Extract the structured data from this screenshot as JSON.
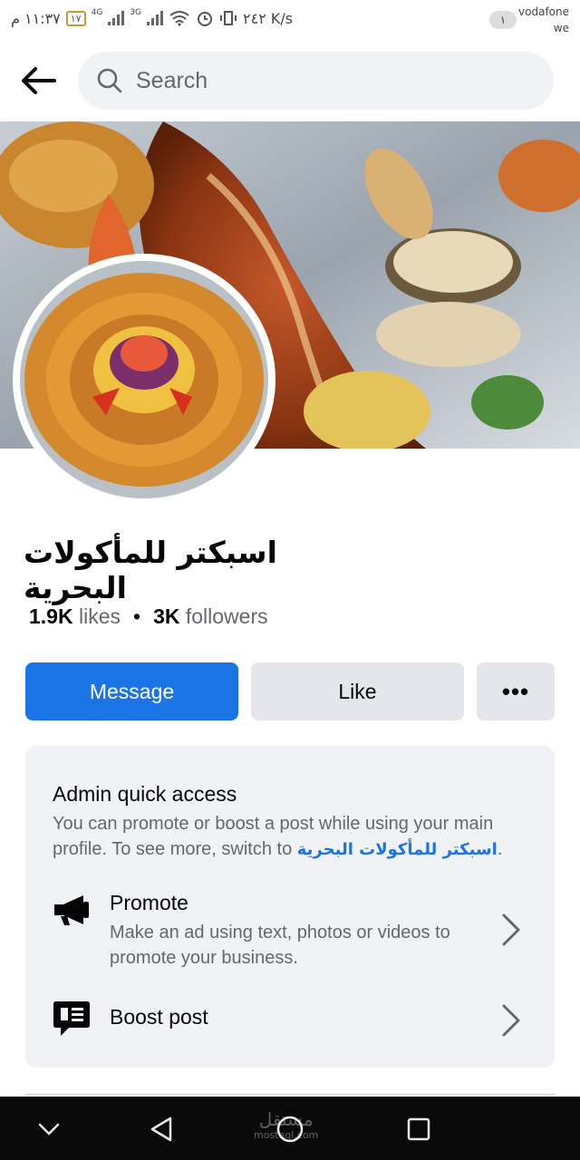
{
  "status_bar": {
    "time": "١١:٣٧ م",
    "battery": "١٧",
    "network_1": "4G",
    "network_2": "3G",
    "speed": "٢٤٢ K/s",
    "sim_badge": "١",
    "carrier_1": "vodafone",
    "carrier_2": "we"
  },
  "header": {
    "search_placeholder": "Search"
  },
  "profile": {
    "name": "اسبكتر للمأكولات البحرية",
    "likes_count": "1.9K",
    "likes_label": "likes",
    "separator": "•",
    "followers_count": "3K",
    "followers_label": "followers"
  },
  "actions": {
    "message_label": "Message",
    "like_label": "Like",
    "more_label": "•••"
  },
  "admin_card": {
    "title": "Admin quick access",
    "description": "You can promote or boost a post while using your main profile. To see more, switch to ",
    "switch_link": "اسبكتر للمأكولات البحرية",
    "description_end": ".",
    "promote": {
      "title": "Promote",
      "description": "Make an ad using text, photos or videos to promote your business."
    },
    "boost": {
      "title": "Boost post"
    }
  },
  "navbar": {
    "watermark": "مستقل",
    "watermark_sub": "mostaql.com"
  },
  "colors": {
    "accent": "#1b74e4",
    "secondary_button": "#e4e6eb",
    "card_background": "#f0f2f5",
    "secondary_text": "#65676b"
  }
}
